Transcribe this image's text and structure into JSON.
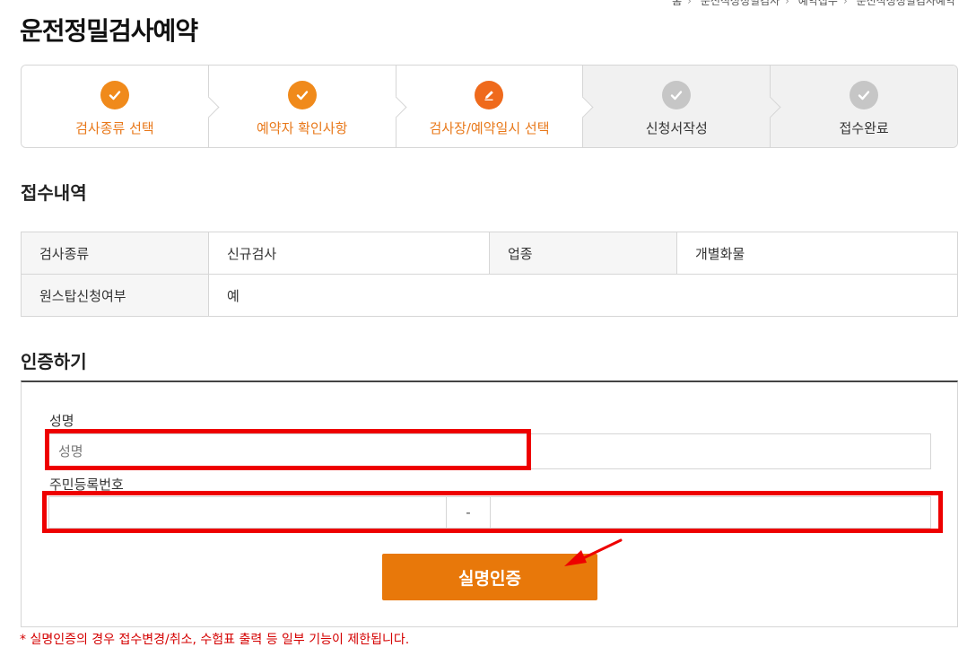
{
  "breadcrumb": [
    "홈",
    "운전적성정밀검사",
    "예약접수",
    "운전적성정밀검사예약"
  ],
  "page_title": "운전정밀검사예약",
  "steps": [
    {
      "label": "검사종류 선택",
      "state": "done",
      "icon": "check-icon"
    },
    {
      "label": "예약자 확인사항",
      "state": "done",
      "icon": "check-icon"
    },
    {
      "label": "검사장/예약일시 선택",
      "state": "current",
      "icon": "pencil-icon"
    },
    {
      "label": "신청서작성",
      "state": "pending",
      "icon": "check-icon"
    },
    {
      "label": "접수완료",
      "state": "pending",
      "icon": "check-icon"
    }
  ],
  "receipt": {
    "title": "접수내역",
    "rows": [
      {
        "label1": "검사종류",
        "value1": "신규검사",
        "label2": "업종",
        "value2": "개별화물"
      },
      {
        "label1": "원스탑신청여부",
        "value1": "예"
      }
    ]
  },
  "auth": {
    "title": "인증하기",
    "name_label": "성명",
    "name_placeholder": "성명",
    "jumin_label": "주민등록번호",
    "jumin_separator": "-",
    "button_label": "실명인증"
  },
  "notice": "* 실명인증의 경우 접수변경/취소, 수험표 출력 등 일부 기능이 제한됩니다.",
  "colors": {
    "accent": "#e8780a",
    "highlight": "#ee0000",
    "notice": "#d40000"
  }
}
